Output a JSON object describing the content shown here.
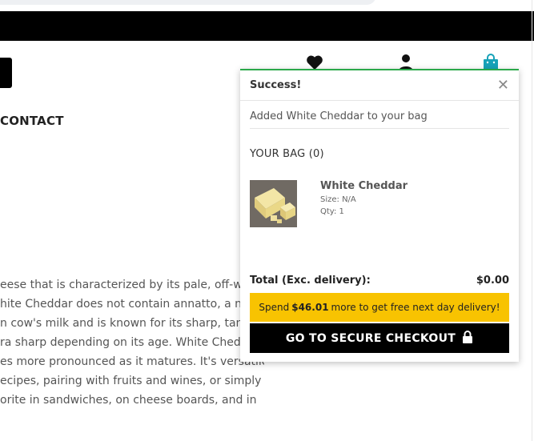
{
  "nav": {
    "contact": "CONTACT"
  },
  "header_icons": {
    "heart": "heart-icon",
    "user": "user-icon",
    "bag": "shopping-bag-icon"
  },
  "product_description": {
    "lines": [
      "eese that is characterized by its pale, off-wh",
      "hite Cheddar does not contain annatto, a nat",
      "n cow's milk and is known for its sharp, tang",
      "ra sharp depending on its age. White Chedd",
      "es more pronounced as it matures. It's versatile",
      "ecipes, pairing with fruits and wines, or simply",
      "orite in sandwiches, on cheese boards, and in"
    ]
  },
  "popup": {
    "title": "Success!",
    "close_icon": "close-icon",
    "message": "Added White Cheddar to your bag",
    "bag_heading": "YOUR BAG (0)",
    "item": {
      "name": "White Cheddar",
      "size": "Size: N/A",
      "qty": "Qty: 1"
    },
    "total_label": "Total (Exc. delivery):",
    "total_value": "$0.00",
    "spend_prefix": "Spend",
    "spend_amount": "$46.01",
    "spend_suffix": "more to get free next day delivery!",
    "checkout_label": "GO TO SECURE CHECKOUT",
    "lock_icon": "lock-icon"
  },
  "colors": {
    "accent_success": "#2aa84a",
    "banner_yellow": "#f8c301",
    "bag_icon": "#17a2b8",
    "dark": "#000000"
  }
}
